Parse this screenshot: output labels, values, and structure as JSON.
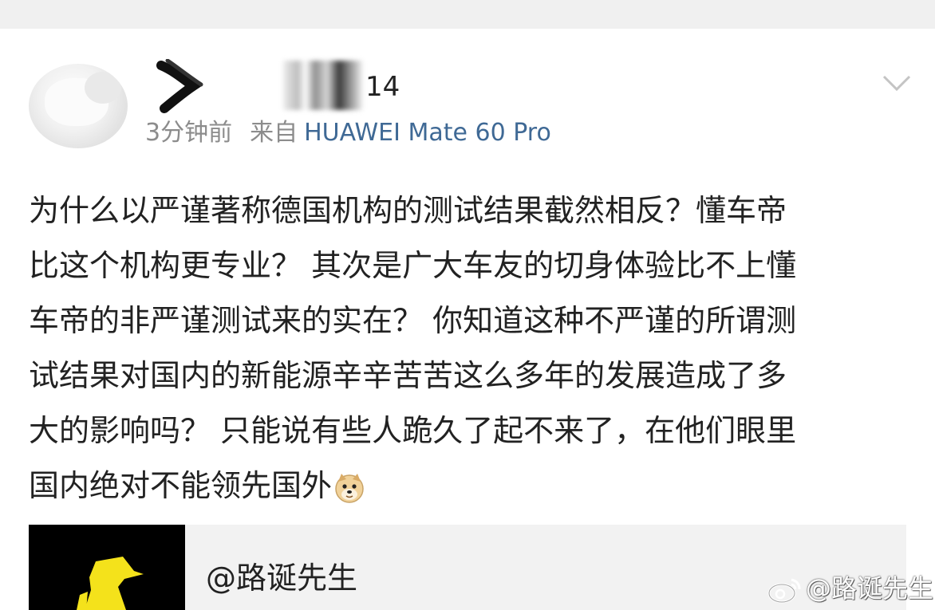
{
  "post": {
    "author_suffix": "14",
    "time": "3分钟前",
    "source_prefix": "来自",
    "device": "HUAWEI Mate 60 Pro",
    "text_lines": [
      "为什么以严谨著称德国机构的测试结果截然相反？懂车帝",
      "比这个机构更专业？ 其次是广大车友的切身体验比不上懂",
      "车帝的非严谨测试来的实在？ 你知道这种不严谨的所谓测",
      "试结果对国内的新能源辛辛苦苦这么多年的发展造成了多",
      "大的影响吗？ 只能说有些人跪久了起不来了，在他们眼里",
      "国内绝对不能领先国外"
    ],
    "emoji": "doge-emoji"
  },
  "quote": {
    "author": "@路诞先生"
  },
  "watermark": {
    "text": "@路诞先生"
  },
  "icons": {
    "more": "chevron-down-icon",
    "avatar": "avatar-placeholder",
    "weibo": "weibo-logo-icon"
  },
  "colors": {
    "link": "#3f6995",
    "meta": "#8c8c8c",
    "text": "#222222",
    "quote_bg": "#f2f2f2",
    "yellow": "#f4e21b"
  }
}
